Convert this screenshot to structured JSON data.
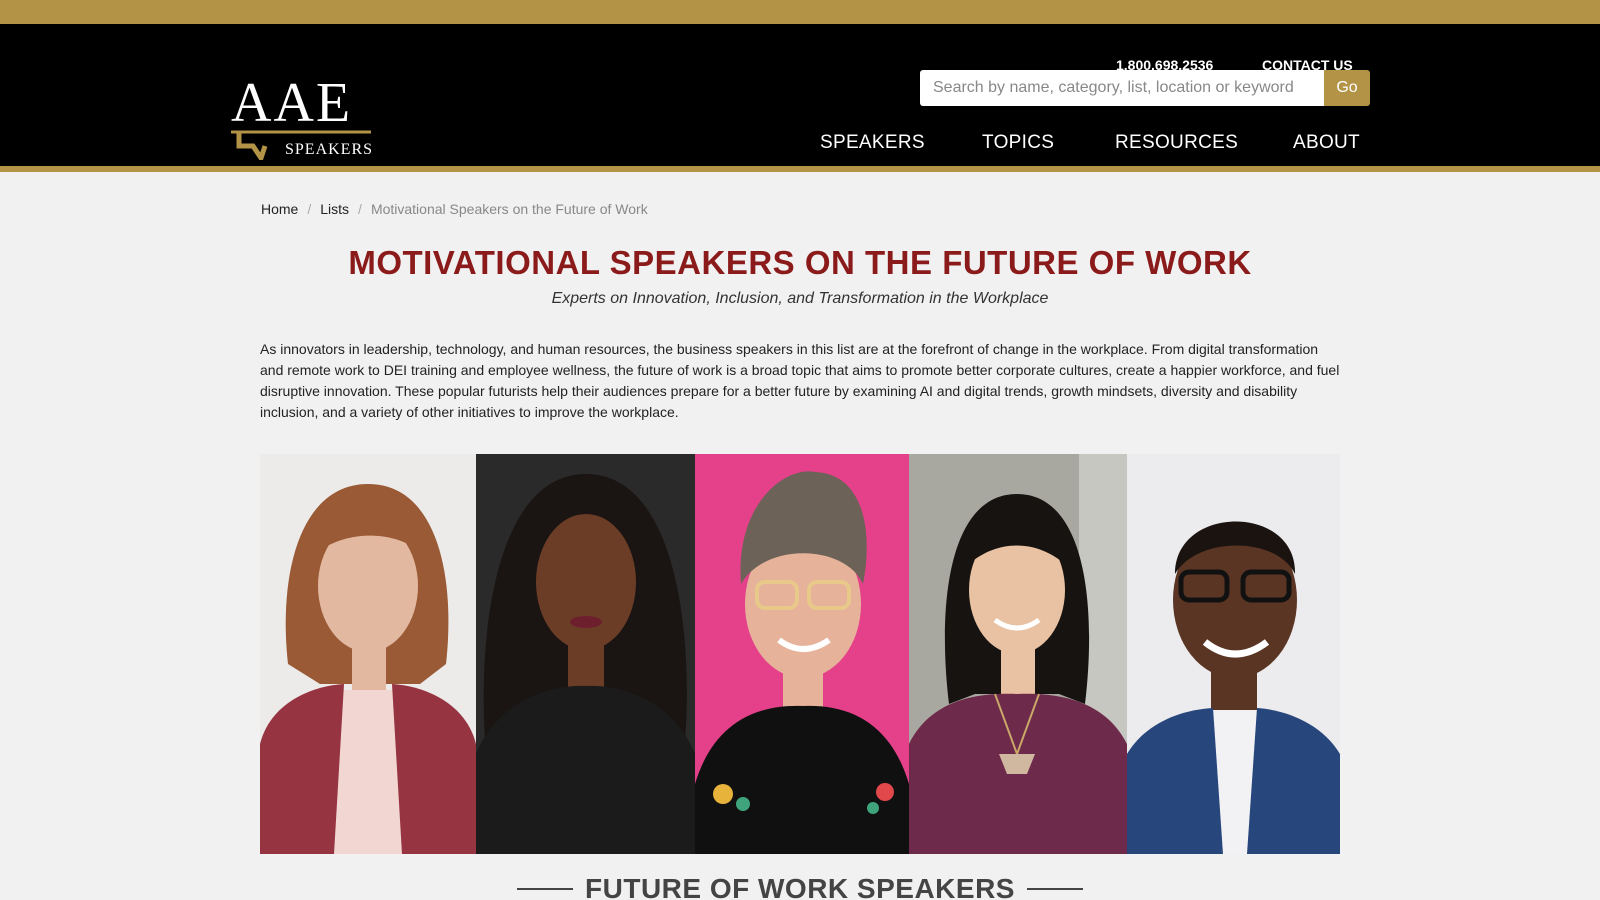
{
  "brand": {
    "logo_letters": "AAE",
    "logo_subtitle": "SPEAKERS",
    "accent": "#b39447",
    "title_color": "#8b1a1a"
  },
  "utility": {
    "phone": "1.800.698.2536",
    "contact": "CONTACT US"
  },
  "search": {
    "placeholder": "Search by name, category, list, location or keyword",
    "value": "",
    "button": "Go"
  },
  "nav": {
    "items": [
      {
        "label": "SPEAKERS"
      },
      {
        "label": "TOPICS"
      },
      {
        "label": "RESOURCES"
      },
      {
        "label": "ABOUT"
      }
    ]
  },
  "breadcrumb": {
    "home": "Home",
    "lists": "Lists",
    "current": "Motivational Speakers on the Future of Work"
  },
  "page": {
    "title": "MOTIVATIONAL SPEAKERS ON THE FUTURE OF WORK",
    "subtitle": "Experts on Innovation, Inclusion, and Transformation in the Workplace",
    "intro": "As innovators in leadership, technology, and human resources, the business speakers in this list are at the forefront of change in the workplace. From digital transformation and remote work to DEI training and employee wellness, the future of work is a broad topic that aims to promote better corporate cultures, create a happier workforce, and fuel disruptive innovation. These popular futurists help their audiences prepare for a better future by examining AI and digital trends, growth mindsets, diversity and disability inclusion, and a variety of other initiatives to improve the workplace.",
    "section_heading": "FUTURE OF WORK SPEAKERS"
  },
  "banner": {
    "panels": [
      {
        "bg": "#ecebea",
        "skin": "#e3b8a1",
        "hair": "#9a5a35",
        "top": "#963442",
        "accent": "#f1d6d2"
      },
      {
        "bg": "#2a2a2a",
        "skin": "#6b3d26",
        "hair": "#1a1412",
        "top": "#1b1b1b",
        "accent": "#6e1f2e"
      },
      {
        "bg": "#e4418a",
        "skin": "#e6b39a",
        "hair": "#6d6258",
        "top": "#101010",
        "accent": "#e8c98a"
      },
      {
        "bg": "#a9a8a0",
        "skin": "#e9c2a3",
        "hair": "#171311",
        "top": "#6d2a4a",
        "accent": "#cfb7a0"
      },
      {
        "bg": "#ecebed",
        "skin": "#5a3523",
        "hair": "#1b1310",
        "top": "#27467c",
        "accent": "#f2f2f5"
      }
    ]
  }
}
